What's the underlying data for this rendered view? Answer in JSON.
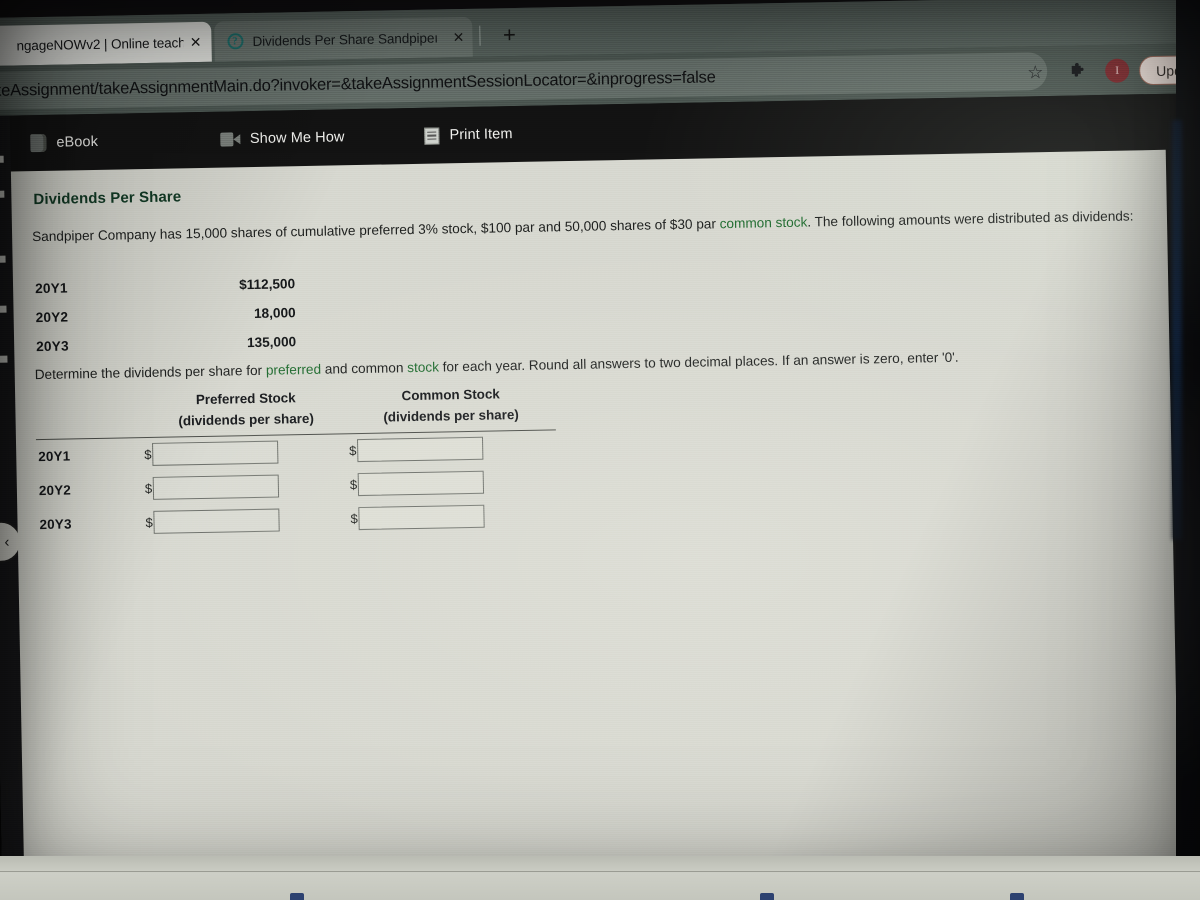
{
  "browser": {
    "tabs": [
      {
        "title": "ngageNOWv2 | Online teach",
        "close": "✕",
        "active": true,
        "favicon": ""
      },
      {
        "title": "Dividends Per Share Sandpipeı",
        "close": "✕",
        "active": false,
        "favicon": "?"
      }
    ],
    "new_tab_label": "+",
    "url": "/takeAssignment/takeAssignmentMain.do?invoker=&takeAssignmentSessionLocator=&inprogress=false",
    "star_icon": "☆",
    "extensions_icon": "puzzle-piece",
    "avatar_initial": "I",
    "update_button": "Update"
  },
  "toolbar": {
    "ebook": "eBook",
    "show_me_how": "Show Me How",
    "print_item": "Print Item"
  },
  "navigation": {
    "back_chevron": "‹"
  },
  "question": {
    "title": "Dividends Per Share",
    "body_part1": "Sandpiper Company has 15,000 shares of cumulative preferred 3% stock, $100 par and 50,000 shares of $30 par ",
    "body_link_common_stock": "common stock",
    "body_part2": ". The following amounts were distributed as dividends:",
    "instruction_part1": "Determine the dividends per share for ",
    "instruction_link_preferred": "preferred",
    "instruction_part2": " and common ",
    "instruction_link_stock": "stock",
    "instruction_part3": " for each year. Round all answers to two decimal places. If an answer is zero, enter '0'.",
    "distributions": [
      {
        "year": "20Y1",
        "amount": "$112,500"
      },
      {
        "year": "20Y2",
        "amount": "18,000"
      },
      {
        "year": "20Y3",
        "amount": "135,000"
      }
    ]
  },
  "answer_table": {
    "col1_header_line1": "Preferred Stock",
    "col1_header_line2": "(dividends per share)",
    "col2_header_line1": "Common Stock",
    "col2_header_line2": "(dividends per share)",
    "currency_symbol": "$",
    "rows": [
      {
        "year": "20Y1",
        "preferred_value": "",
        "common_value": ""
      },
      {
        "year": "20Y2",
        "preferred_value": "",
        "common_value": ""
      },
      {
        "year": "20Y3",
        "preferred_value": "",
        "common_value": ""
      }
    ]
  },
  "colors": {
    "link_green": "#1f6b2f",
    "title_green": "#123a25",
    "update_border": "#9c6a5c",
    "avatar_bg": "#7e2a2f"
  }
}
